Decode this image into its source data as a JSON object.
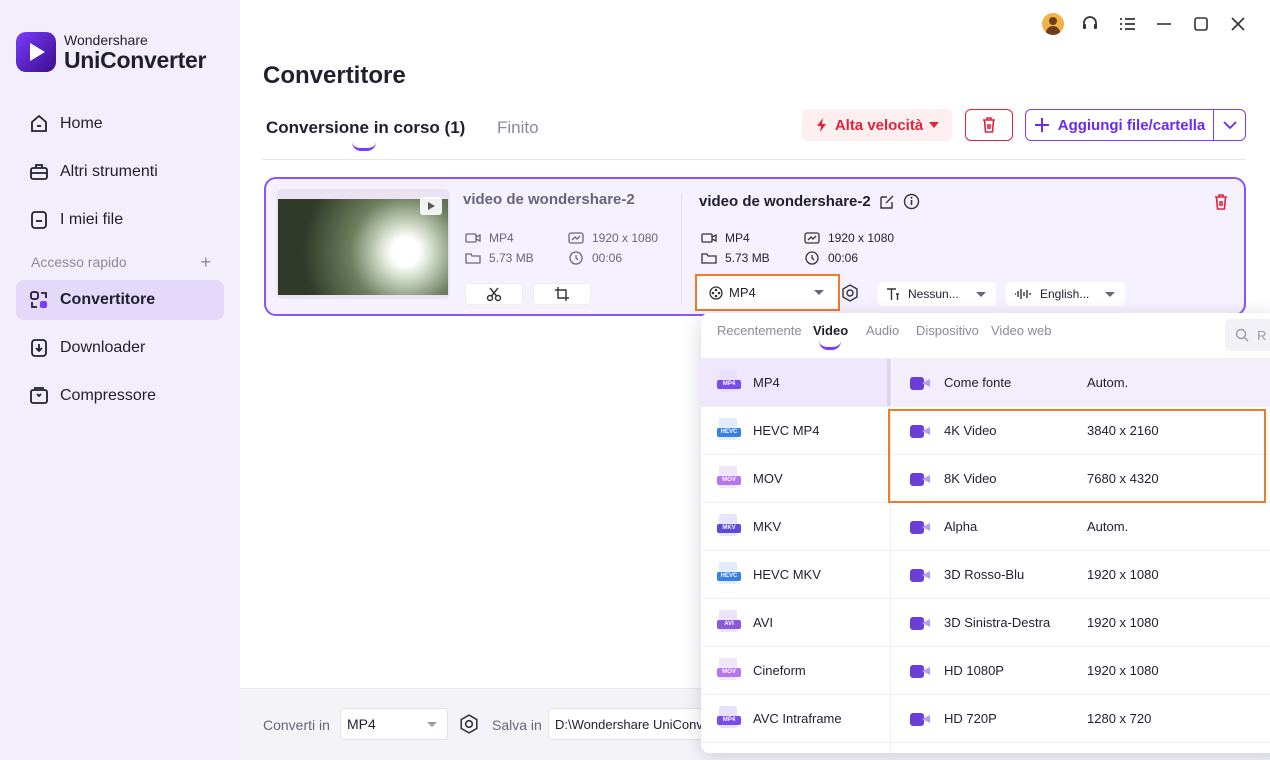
{
  "app": {
    "brand_top": "Wondershare",
    "brand_name": "UniConverter"
  },
  "sidebar": {
    "items": [
      {
        "label": "Home",
        "icon": "home-icon"
      },
      {
        "label": "Altri strumenti",
        "icon": "toolbox-icon"
      },
      {
        "label": "I miei file",
        "icon": "file-icon"
      }
    ],
    "quick_access_label": "Accesso rapido",
    "quick_items": [
      {
        "label": "Convertitore",
        "icon": "converter-icon",
        "active": true
      },
      {
        "label": "Downloader",
        "icon": "download-icon"
      },
      {
        "label": "Compressore",
        "icon": "compress-icon"
      }
    ]
  },
  "header": {
    "page_title": "Convertitore",
    "tab_active": "Conversione in corso (1)",
    "tab_inactive": "Finito",
    "speed_label": "Alta velocità",
    "add_label": "Aggiungi file/cartella"
  },
  "file": {
    "source_name": "video de wondershare-2",
    "source_format": "MP4",
    "source_size": "5.73 MB",
    "source_resolution": "1920 x 1080",
    "source_duration": "00:06",
    "output_name": "video de wondershare-2",
    "output_format": "MP4",
    "output_size": "5.73 MB",
    "output_resolution": "1920 x 1080",
    "output_duration": "00:06",
    "format_select": "MP4",
    "subtitle_select": "Nessun...",
    "audio_select": "English..."
  },
  "bottom": {
    "convert_label": "Converti in",
    "convert_value": "MP4",
    "save_label": "Salva in",
    "save_path": "D:\\Wondershare UniConv"
  },
  "popup": {
    "tabs": [
      "Recentemente",
      "Video",
      "Audio",
      "Dispositivo",
      "Video web"
    ],
    "active_tab": "Video",
    "search_placeholder": "R",
    "formats": [
      {
        "label": "MP4",
        "tag": "MP4",
        "color": "#7a4cf0"
      },
      {
        "label": "HEVC MP4",
        "tag": "HEVC",
        "color": "#3a7ee8"
      },
      {
        "label": "MOV",
        "tag": "MOV",
        "color": "#b476e8"
      },
      {
        "label": "MKV",
        "tag": "MKV",
        "color": "#5a4ad8"
      },
      {
        "label": "HEVC MKV",
        "tag": "HEVC",
        "color": "#3a7ee8"
      },
      {
        "label": "AVI",
        "tag": "AVI",
        "color": "#8a5ad8"
      },
      {
        "label": "Cineform",
        "tag": "MOV",
        "color": "#b476e8"
      },
      {
        "label": "AVC Intraframe",
        "tag": "MP4",
        "color": "#7a4cf0"
      }
    ],
    "presets": [
      {
        "name": "Come fonte",
        "res": "Autom."
      },
      {
        "name": "4K Video",
        "res": "3840 x 2160"
      },
      {
        "name": "8K Video",
        "res": "7680 x 4320"
      },
      {
        "name": "Alpha",
        "res": "Autom."
      },
      {
        "name": "3D Rosso-Blu",
        "res": "1920 x 1080"
      },
      {
        "name": "3D Sinistra-Destra",
        "res": "1920 x 1080"
      },
      {
        "name": "HD 1080P",
        "res": "1920 x 1080"
      },
      {
        "name": "HD 720P",
        "res": "1280 x 720"
      }
    ]
  },
  "colors": {
    "accent": "#7a3cff",
    "danger": "#e0253a",
    "highlight": "#ee7a2a"
  }
}
